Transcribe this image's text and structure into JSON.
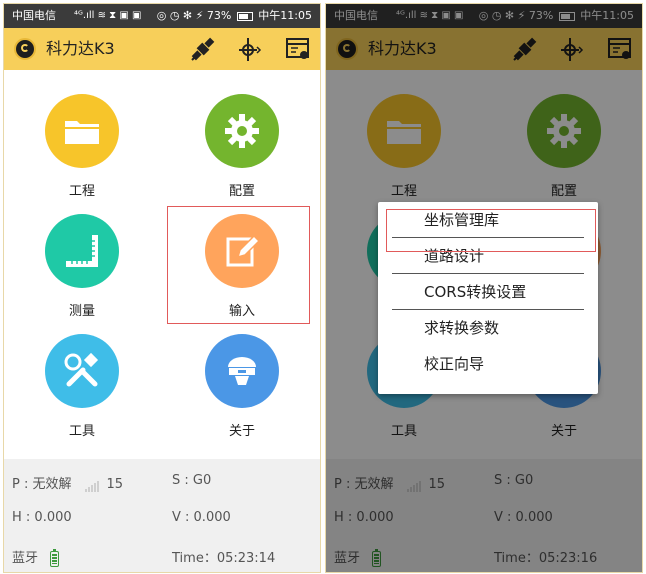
{
  "statusbar": {
    "carrier": "中国电信",
    "indicators": "⁴ᴳ.ıll ≋ ⧗ ▣ ▣",
    "right_left": "◎ ◷ ✻ ⚡ 73%",
    "time_left": "中午11:05",
    "right_right": "◎ ◷ ✻ ⚡ 73%",
    "time_right": "中午11:05"
  },
  "appbar": {
    "title": "科力达K3",
    "icons": [
      "satellite-icon",
      "antenna-icon",
      "settings-panel-icon"
    ]
  },
  "grid": {
    "items": [
      {
        "key": "project",
        "label": "工程",
        "color": "#f7c52a",
        "icon": "folder-icon"
      },
      {
        "key": "config",
        "label": "配置",
        "color": "#74b52e",
        "icon": "gear-icon"
      },
      {
        "key": "survey",
        "label": "测量",
        "color": "#1fc9a6",
        "icon": "ruler-icon"
      },
      {
        "key": "input",
        "label": "输入",
        "color": "#ffa45c",
        "icon": "edit-icon"
      },
      {
        "key": "tools",
        "label": "工具",
        "color": "#3fbde8",
        "icon": "tools-icon"
      },
      {
        "key": "about",
        "label": "关于",
        "color": "#4b97e6",
        "icon": "receiver-icon"
      }
    ]
  },
  "info": {
    "position_status": "P : 无效解",
    "satellites": "15",
    "s_value": "S : G0",
    "h_value": "H : 0.000",
    "v_value": "V : 0.000",
    "bluetooth": "蓝牙",
    "time_label": "Time：",
    "time_left": "05:23:14",
    "time_right": "05:23:16"
  },
  "popup": {
    "items": [
      "坐标管理库",
      "道路设计",
      "CORS转换设置",
      "求转换参数",
      "校正向导"
    ]
  },
  "colors": {
    "appbar": "#f7cf5a",
    "highlight": "#e15a5a",
    "statusbar": "#3b3b3b"
  }
}
